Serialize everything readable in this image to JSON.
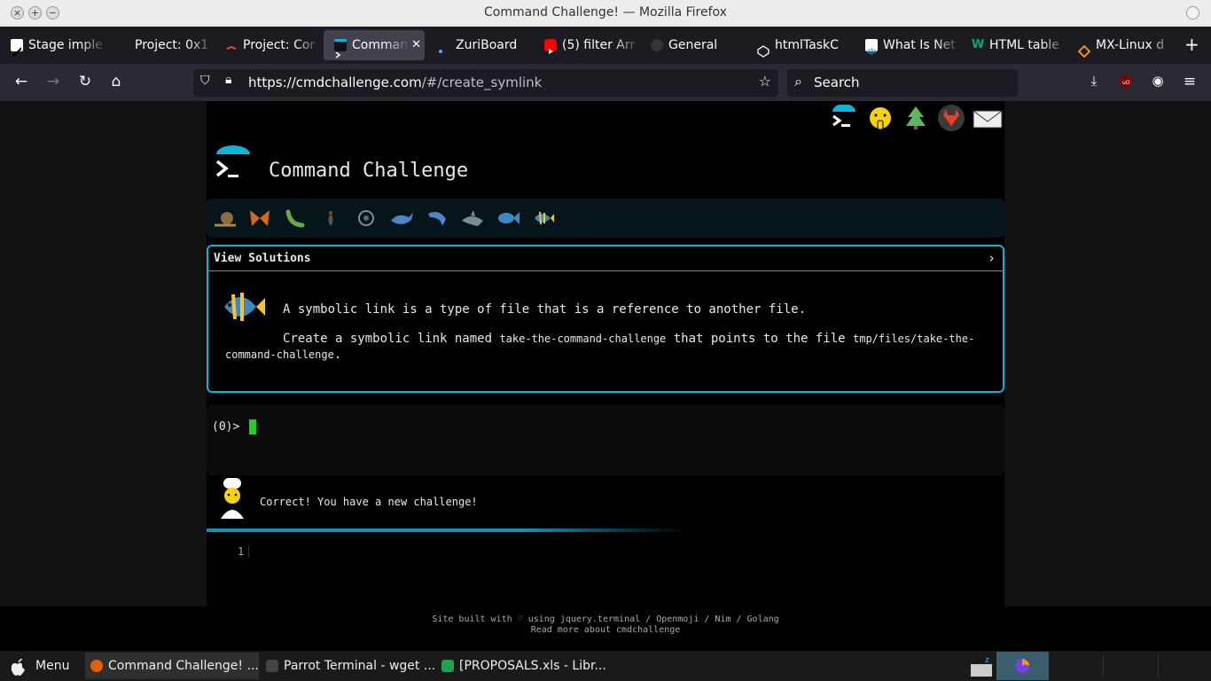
{
  "window": {
    "title": "Command Challenge! — Mozilla Firefox"
  },
  "tabs": [
    {
      "label": "Stage imple",
      "icon": "zuri-icon",
      "color": "#ffffff"
    },
    {
      "label": "Project: 0x1",
      "icon": "holberton-icon",
      "color": "#e04e39"
    },
    {
      "label": "Project: Cor",
      "icon": "holberton-icon",
      "color": "#e04e39"
    },
    {
      "label": "Comman",
      "icon": "terminal-icon",
      "color": "#0fb3d8",
      "active": true
    },
    {
      "label": "ZuriBoard",
      "icon": "dot-icon",
      "color": "#5aa3ff"
    },
    {
      "label": "(5) filter Arr",
      "icon": "youtube-icon",
      "color": "#ff0000"
    },
    {
      "label": "General",
      "icon": "github-icon",
      "color": "#333333"
    },
    {
      "label": "htmlTaskC",
      "icon": "codepen-icon",
      "color": "#ffffff"
    },
    {
      "label": "What Is Net",
      "icon": "cisco-icon",
      "color": "#ffffff"
    },
    {
      "label": "HTML table",
      "icon": "w3-icon",
      "color": "#04aa6d"
    },
    {
      "label": "MX-Linux d",
      "icon": "diamond-icon",
      "color": "#f28c28"
    }
  ],
  "nav": {
    "url_host": "https://cmdchallenge.com",
    "url_path": "/#/create_symlink",
    "search_placeholder": "Search"
  },
  "page": {
    "heading": "Command Challenge",
    "view_solutions": "View Solutions",
    "chevron": "›",
    "description": "A symbolic link is a type of file that is a reference to another file.",
    "task_prefix": "Create a symbolic link named ",
    "task_link_name": "take-the-command-challenge",
    "task_middle": " that points to the file ",
    "task_target": "tmp/files/take-the-command-challenge",
    "task_suffix": ".",
    "prompt": "(0)>",
    "message": "Correct! You have a new challenge!",
    "line_number": "1",
    "footer_line1": "Site built with ♡ using jquery.terminal / Openmoji / Nim / Golang",
    "footer_line2": "Read more about cmdchallenge"
  },
  "taskbar": {
    "menu_label": "Menu",
    "tasks": [
      {
        "label": "Command Challenge! ...",
        "color": "#e66000",
        "active": true
      },
      {
        "label": "Parrot Terminal - wget ...",
        "color": "#444444"
      },
      {
        "label": "[PROPOSALS.xls - Libr...",
        "color": "#22a052"
      }
    ]
  },
  "colors": {
    "accent": "#0fb3d8",
    "cursor": "#1ed21e"
  }
}
